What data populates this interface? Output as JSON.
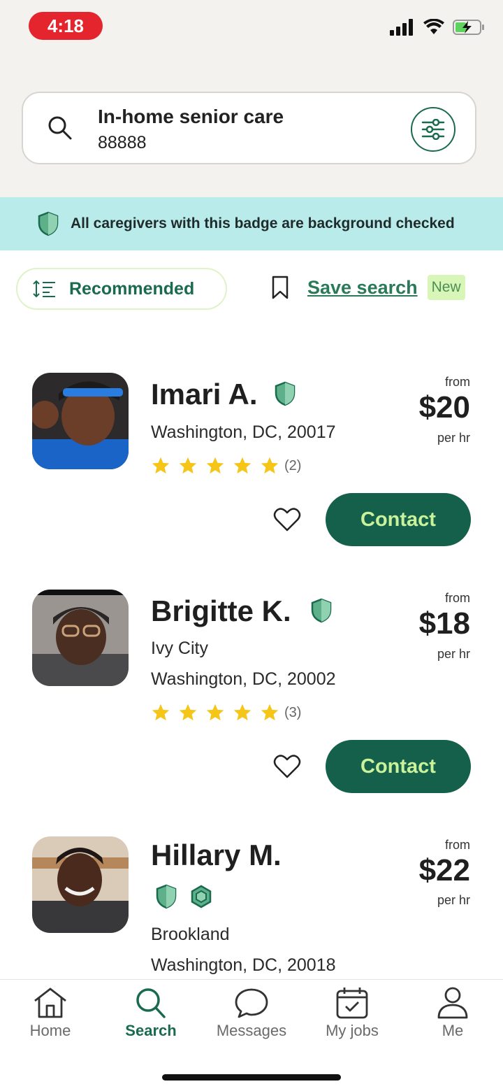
{
  "status_bar": {
    "time": "4:18"
  },
  "search": {
    "title": "In-home senior care",
    "zip": "88888"
  },
  "banner": {
    "text": "All caregivers with this badge are background checked"
  },
  "sort": {
    "label": "Recommended"
  },
  "save_search": {
    "label": "Save search",
    "badge": "New"
  },
  "caregivers": [
    {
      "name": "Imari A.",
      "neighborhood": "",
      "location": "Washington, DC, 20017",
      "rating": 5,
      "reviews": "(2)",
      "from": "from",
      "price": "$20",
      "per": "per hr",
      "contact": "Contact"
    },
    {
      "name": "Brigitte K.",
      "neighborhood": "Ivy City",
      "location": "Washington, DC, 20002",
      "rating": 5,
      "reviews": "(3)",
      "from": "from",
      "price": "$18",
      "per": "per hr",
      "contact": "Contact"
    },
    {
      "name": "Hillary M.",
      "neighborhood": "Brookland",
      "location": "Washington, DC, 20018",
      "from": "from",
      "price": "$22",
      "per": "per hr"
    }
  ],
  "tabs": [
    {
      "label": "Home",
      "icon": "home-icon"
    },
    {
      "label": "Search",
      "icon": "search-icon",
      "active": true
    },
    {
      "label": "Messages",
      "icon": "message-icon"
    },
    {
      "label": "My jobs",
      "icon": "calendar-check-icon"
    },
    {
      "label": "Me",
      "icon": "person-icon"
    }
  ],
  "colors": {
    "brand_green": "#14604a",
    "accent_lime": "#c9f29a",
    "banner_bg": "#b9ebeb",
    "star": "#f5c518"
  }
}
